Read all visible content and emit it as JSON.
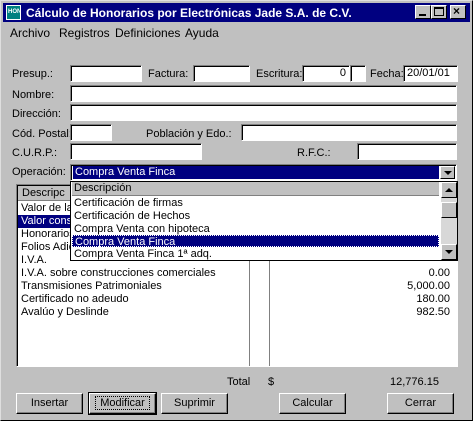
{
  "window": {
    "title": "Cálculo de Honorarios por Electrónicas Jade S.A. de C.V.",
    "icon_text": "HON"
  },
  "menu": [
    "Archivo",
    "Registros",
    "Definiciones",
    "Ayuda"
  ],
  "form": {
    "presup_label": "Presup.:",
    "presup_value": "",
    "factura_label": "Factura:",
    "factura_value": "",
    "escritura_label": "Escritura:",
    "escritura_value": "0",
    "fecha_label": "Fecha:",
    "fecha_value": "20/01/01",
    "nombre_label": "Nombre:",
    "nombre_value": "",
    "direccion_label": "Dirección:",
    "direccion_value": "",
    "cp_label": "Cód. Postal:",
    "cp_value": "",
    "poblacion_label": "Población y Edo.:",
    "poblacion_value": "",
    "curp_label": "C.U.R.P.:",
    "curp_value": "",
    "rfc_label": "R.F.C.:",
    "rfc_value": "",
    "operacion_label": "Operación:",
    "operacion_value": "Compra Venta Finca"
  },
  "dropdown": {
    "header": "Descripción",
    "items": [
      "Certificación de firmas",
      "Certificación de Hechos",
      "Compra Venta con hipoteca",
      "Compra Venta Finca",
      "Compra Venta Finca 1ª adq."
    ],
    "selected_index": 3
  },
  "grid": {
    "header": "Descripc",
    "rows": [
      {
        "desc": "Valor de la",
        "value": ""
      },
      {
        "desc": "Valor cons",
        "value": ""
      },
      {
        "desc": "Honorarios",
        "value": ""
      },
      {
        "desc": "Folios Adic",
        "value": ""
      },
      {
        "desc": "I.V.A.",
        "value": ""
      },
      {
        "desc": "I.V.A. sobre construcciones comerciales",
        "value": "0.00"
      },
      {
        "desc": "Transmisiones Patrimoniales",
        "value": "5,000.00"
      },
      {
        "desc": "Certificado no adeudo",
        "value": "180.00"
      },
      {
        "desc": "Avalúo y Deslinde",
        "value": "982.50"
      }
    ],
    "selected_row": 1
  },
  "total": {
    "label": "Total",
    "currency": "$",
    "value": "12,776.15"
  },
  "buttons": {
    "insertar": "Insertar",
    "modificar": "Modificar",
    "suprimir": "Suprimir",
    "calcular": "Calcular",
    "cerrar": "Cerrar"
  }
}
